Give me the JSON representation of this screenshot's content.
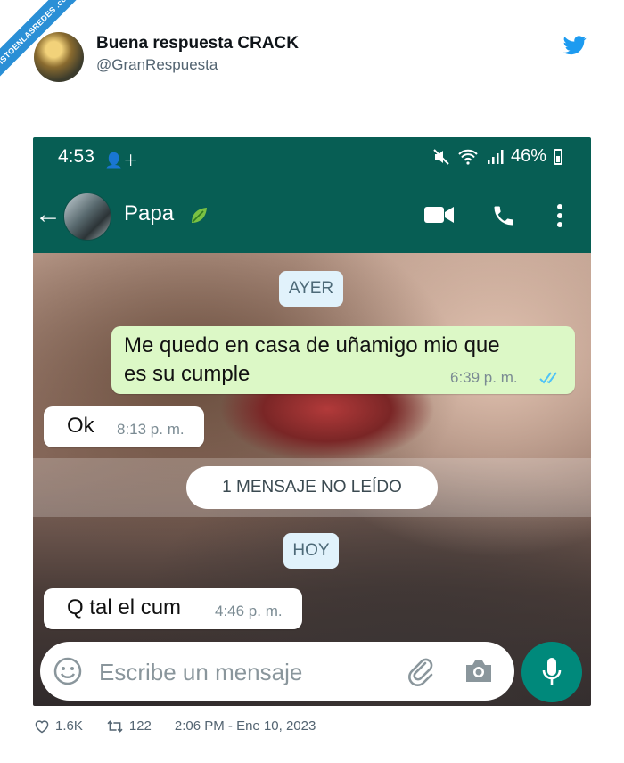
{
  "watermark": "VISTOENLASREDES .com",
  "tweet": {
    "author_name": "Buena respuesta CRACK",
    "author_handle": "@GranRespuesta",
    "likes": "1.6K",
    "retweets": "122",
    "timestamp": "2:06 PM - Ene 10, 2023"
  },
  "phone": {
    "status_bar": {
      "time": "4:53",
      "battery": "46%"
    },
    "app_bar": {
      "contact_name": "Papa"
    },
    "chat": {
      "date_yesterday": "AYER",
      "outgoing": {
        "text": "Me quedo en casa de uñamigo mio que es su cumple",
        "line1": "Me quedo en casa de uñamigo mio que",
        "line2": "es su cumple",
        "time": "6:39 p. m."
      },
      "incoming_1": {
        "text": "Ok",
        "time": "8:13 p. m."
      },
      "unread_banner": "1 MENSAJE NO LEÍDO",
      "date_today": "HOY",
      "incoming_2": {
        "text": "Q tal el cum",
        "time": "4:46 p. m."
      }
    },
    "composer": {
      "placeholder": "Escribe un mensaje"
    }
  },
  "colors": {
    "whatsapp_header": "#075e54",
    "outgoing_bubble": "#dcf8c6",
    "mic_button": "#00897b",
    "read_ticks": "#4fc3f7",
    "twitter_blue": "#1d9bf0"
  },
  "icons": [
    "twitter-bird-icon",
    "back-arrow-icon",
    "leaf-emoji-icon",
    "video-call-icon",
    "phone-call-icon",
    "more-vert-icon",
    "emoji-icon",
    "attach-clip-icon",
    "camera-icon",
    "mic-icon",
    "heart-icon",
    "retweet-icon"
  ]
}
